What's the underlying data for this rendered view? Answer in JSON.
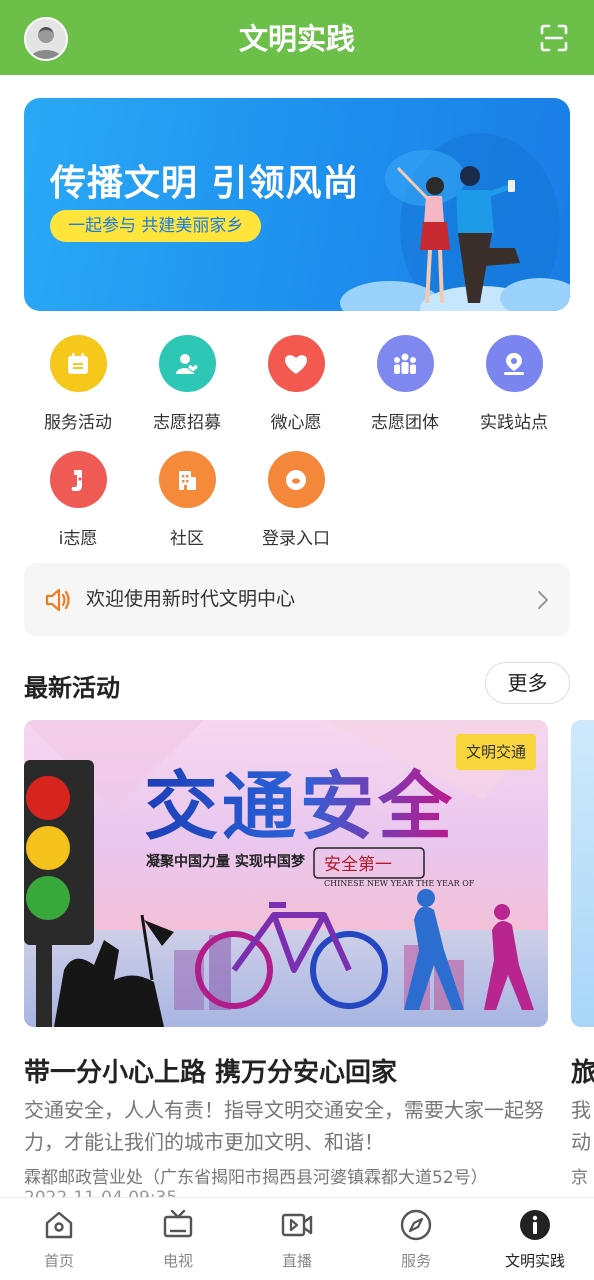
{
  "header": {
    "title": "文明实践"
  },
  "banner": {
    "title": "传播文明 引领风尚",
    "subtitle": "一起参与 共建美丽家乡"
  },
  "grid": {
    "items": [
      {
        "label": "服务活动",
        "icon": "calendar-icon",
        "color": "#f7c81c"
      },
      {
        "label": "志愿招募",
        "icon": "volunteer-heart-icon",
        "color": "#2ec7b5"
      },
      {
        "label": "微心愿",
        "icon": "heart-icon",
        "color": "#f4594f"
      },
      {
        "label": "志愿团体",
        "icon": "group-icon",
        "color": "#7f88ef"
      },
      {
        "label": "实践站点",
        "icon": "location-icon",
        "color": "#7a85ef"
      },
      {
        "label": "i志愿",
        "icon": "hand-icon",
        "color": "#ef5a55"
      },
      {
        "label": "社区",
        "icon": "building-icon",
        "color": "#f58a3b"
      },
      {
        "label": "登录入口",
        "icon": "login-icon",
        "color": "#f5873a"
      }
    ]
  },
  "notice": {
    "text": "欢迎使用新时代文明中心"
  },
  "section": {
    "title": "最新活动",
    "more": "更多"
  },
  "cards": [
    {
      "tag": "文明交通",
      "image_title": "交通安全",
      "image_slogan": "凝聚中国力量 实现中国梦",
      "image_badge": "安全第一",
      "image_eng": "CHINESE NEW YEAR THE YEAR OF",
      "title": "带一分小心上路 携万分安心回家",
      "desc": "交通安全，人人有责！指导文明交通安全，需要大家一起努力，才能让我们的城市更加文明、和谐！",
      "address": "霖都邮政营业处（广东省揭阳市揭西县河婆镇霖都大道52号）",
      "date": "2022-11-04 09:35"
    },
    {
      "title": "旅",
      "desc_line1": "我",
      "desc_line2": "动",
      "address": "京"
    }
  ],
  "bottom_nav": [
    {
      "label": "首页",
      "icon": "home-icon"
    },
    {
      "label": "电视",
      "icon": "tv-icon"
    },
    {
      "label": "直播",
      "icon": "live-icon"
    },
    {
      "label": "服务",
      "icon": "compass-icon"
    },
    {
      "label": "文明实践",
      "icon": "info-icon",
      "active": true
    }
  ],
  "colors": {
    "brand_green": "#6cc04a",
    "banner_blue": "#1e8fee",
    "tag_yellow": "#f8d53c"
  }
}
